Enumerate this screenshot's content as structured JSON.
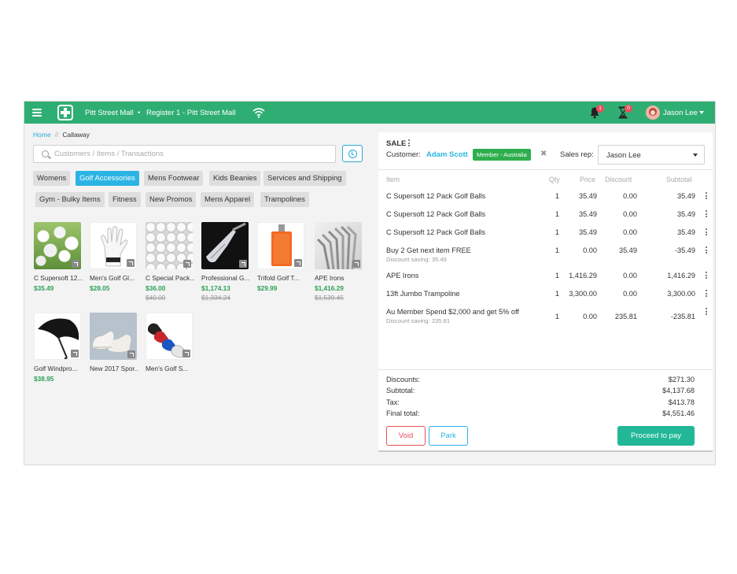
{
  "topbar": {
    "store": "Pitt Street Mall",
    "separator": "•",
    "register": "Register 1 - Pitt Street Mall",
    "notifications_count": "1",
    "pending_count": "0",
    "user": "Jason Lee"
  },
  "breadcrumb": {
    "home": "Home",
    "separator": "//",
    "current": "Callaway"
  },
  "search": {
    "placeholder": "Customers / Items / Transactions",
    "value": ""
  },
  "categories": [
    {
      "label": "Womens",
      "active": false
    },
    {
      "label": "Golf Accessories",
      "active": true
    },
    {
      "label": "Mens Footwear",
      "active": false
    },
    {
      "label": "Kids Beanies",
      "active": false
    },
    {
      "label": "Services and Shipping",
      "active": false
    },
    {
      "label": "Gym - Bulky Items",
      "active": false
    },
    {
      "label": "Fitness",
      "active": false
    },
    {
      "label": "New Promos",
      "active": false
    },
    {
      "label": "Mens Apparel",
      "active": false
    },
    {
      "label": "Trampolines",
      "active": false
    }
  ],
  "products": [
    {
      "name": "C Supersoft 12...",
      "price": "$35.49",
      "old_price": "",
      "image": "golf-balls-on-grass"
    },
    {
      "name": "Men's Golf Gl...",
      "price": "$28.05",
      "old_price": "",
      "image": "white-golf-glove"
    },
    {
      "name": "C Special Pack...",
      "price": "$36.00",
      "old_price": "$40.00",
      "image": "pile-of-golf-balls"
    },
    {
      "name": "Professional G...",
      "price": "$1,174.13",
      "old_price": "$1,334.24",
      "image": "golf-iron-club-head"
    },
    {
      "name": "Trifold Golf T...",
      "price": "$29.99",
      "old_price": "",
      "image": "orange-golf-towel"
    },
    {
      "name": "APE Irons",
      "price": "$1,416.29",
      "old_price": "$1,539.45",
      "image": "set-of-irons"
    },
    {
      "name": "Golf Windpro...",
      "price": "$38.95",
      "old_price": "",
      "image": "black-umbrella"
    },
    {
      "name": "New 2017 Spor...",
      "price": "",
      "old_price": "",
      "image": "white-sneakers"
    },
    {
      "name": "Men's Golf S...",
      "price": "",
      "old_price": "",
      "image": "golf-shoes"
    }
  ],
  "sale": {
    "title": "SALE",
    "customer_label": "Customer:",
    "customer_name": "Adam Scott",
    "member_badge": "Member - Australia",
    "remove_glyph": "✖",
    "sales_rep_label": "Sales rep:",
    "sales_rep": "Jason Lee",
    "columns": {
      "item": "Item",
      "qty": "Qty",
      "price": "Price",
      "discount": "Discount",
      "subtotal": "Subtotal"
    },
    "lines": [
      {
        "item": "C Supersoft 12 Pack Golf Balls",
        "saving": "",
        "qty": "1",
        "price": "35.49",
        "discount": "0.00",
        "subtotal": "35.49"
      },
      {
        "item": "C Supersoft 12 Pack Golf Balls",
        "saving": "",
        "qty": "1",
        "price": "35.49",
        "discount": "0.00",
        "subtotal": "35.49"
      },
      {
        "item": "C Supersoft 12 Pack Golf Balls",
        "saving": "",
        "qty": "1",
        "price": "35.49",
        "discount": "0.00",
        "subtotal": "35.49"
      },
      {
        "item": "Buy 2 Get next item FREE",
        "saving": "Discount saving: 35.49",
        "qty": "1",
        "price": "0.00",
        "discount": "35.49",
        "subtotal": "-35.49"
      },
      {
        "item": "APE Irons",
        "saving": "",
        "qty": "1",
        "price": "1,416.29",
        "discount": "0.00",
        "subtotal": "1,416.29"
      },
      {
        "item": "13ft Jumbo Trampoline",
        "saving": "",
        "qty": "1",
        "price": "3,300.00",
        "discount": "0.00",
        "subtotal": "3,300.00"
      },
      {
        "item": "Au Member Spend $2,000 and get 5% off",
        "saving": "Discount saving: 235.81",
        "qty": "1",
        "price": "0.00",
        "discount": "235.81",
        "subtotal": "-235.81"
      }
    ],
    "totals": {
      "discounts_label": "Discounts:",
      "discounts": "$271.30",
      "subtotal_label": "Subtotal:",
      "subtotal": "$4,137.68",
      "tax_label": "Tax:",
      "tax": "$413.78",
      "final_label": "Final total:",
      "final": "$4,551.46"
    },
    "buttons": {
      "void": "Void",
      "park": "Park",
      "pay": "Proceed to pay"
    }
  },
  "colors": {
    "header": "#2fae74",
    "accent": "#2bb4e3",
    "price": "#2d9f5a",
    "pay": "#22b797",
    "void": "#e8505b",
    "member": "#2fae4e"
  }
}
